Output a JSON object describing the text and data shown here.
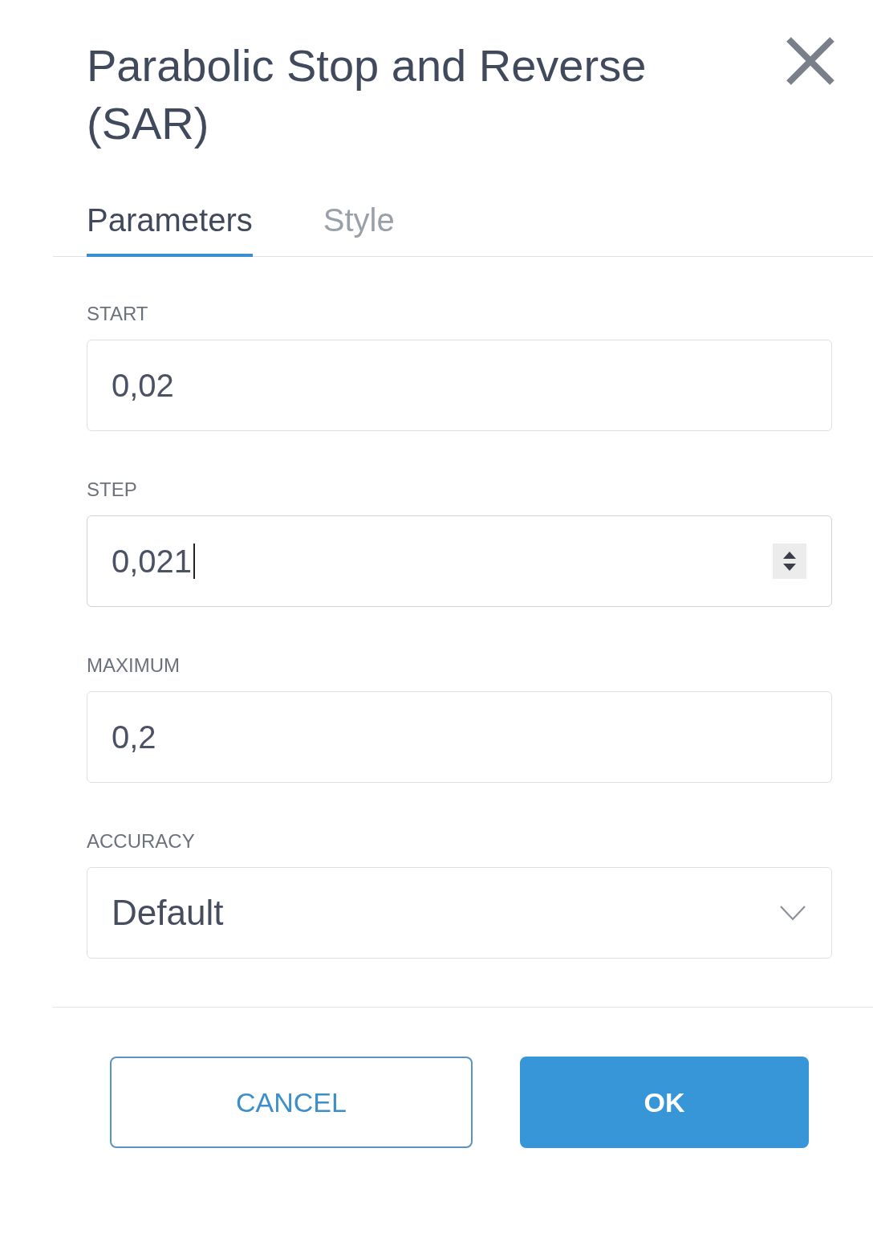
{
  "dialog": {
    "title": "Parabolic Stop and Reverse (SAR)"
  },
  "tabs": [
    {
      "label": "Parameters",
      "selected": true
    },
    {
      "label": "Style",
      "selected": false
    }
  ],
  "fields": [
    {
      "kind": "number",
      "label": "START",
      "value": "0,02",
      "focused": false
    },
    {
      "kind": "number",
      "label": "STEP",
      "value": "0,021",
      "focused": true
    },
    {
      "kind": "number",
      "label": "MAXIMUM",
      "value": "0,2",
      "focused": false
    },
    {
      "kind": "select",
      "label": "ACCURACY",
      "value": "Default",
      "focused": false
    }
  ],
  "buttons": [
    {
      "kind": "secondary",
      "label": "CANCEL"
    },
    {
      "kind": "primary",
      "label": "OK"
    }
  ]
}
